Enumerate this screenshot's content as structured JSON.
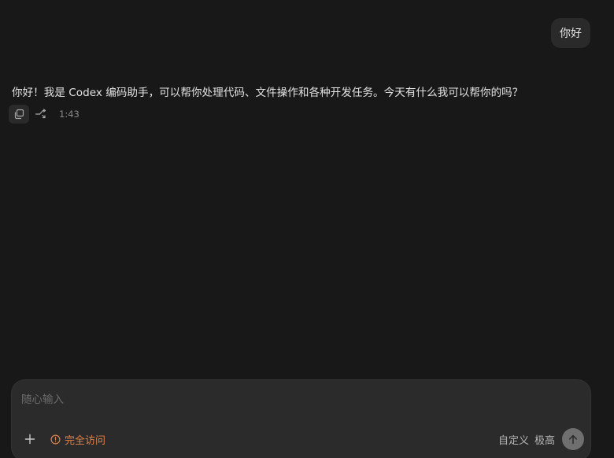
{
  "conversation": {
    "user_message": "你好",
    "assistant_message": "你好！我是 Codex 编码助手，可以帮你处理代码、文件操作和各种开发任务。今天有什么我可以帮你的吗？",
    "timestamp": "1:43"
  },
  "actions": {
    "copy_icon": "copy-icon",
    "branch_icon": "branch-icon"
  },
  "composer": {
    "placeholder": "随心输入",
    "plus_icon": "plus-icon",
    "access_label": "完全访问",
    "access_icon": "warning-circle-icon",
    "mode_label": "自定义",
    "effort_label": "极高",
    "send_icon": "arrow-up-icon"
  },
  "colors": {
    "background": "#181818",
    "bubble": "#2a2a2a",
    "composer": "#2b2b2b",
    "access_accent": "#e0824a",
    "send_button": "#6f6f6f"
  }
}
